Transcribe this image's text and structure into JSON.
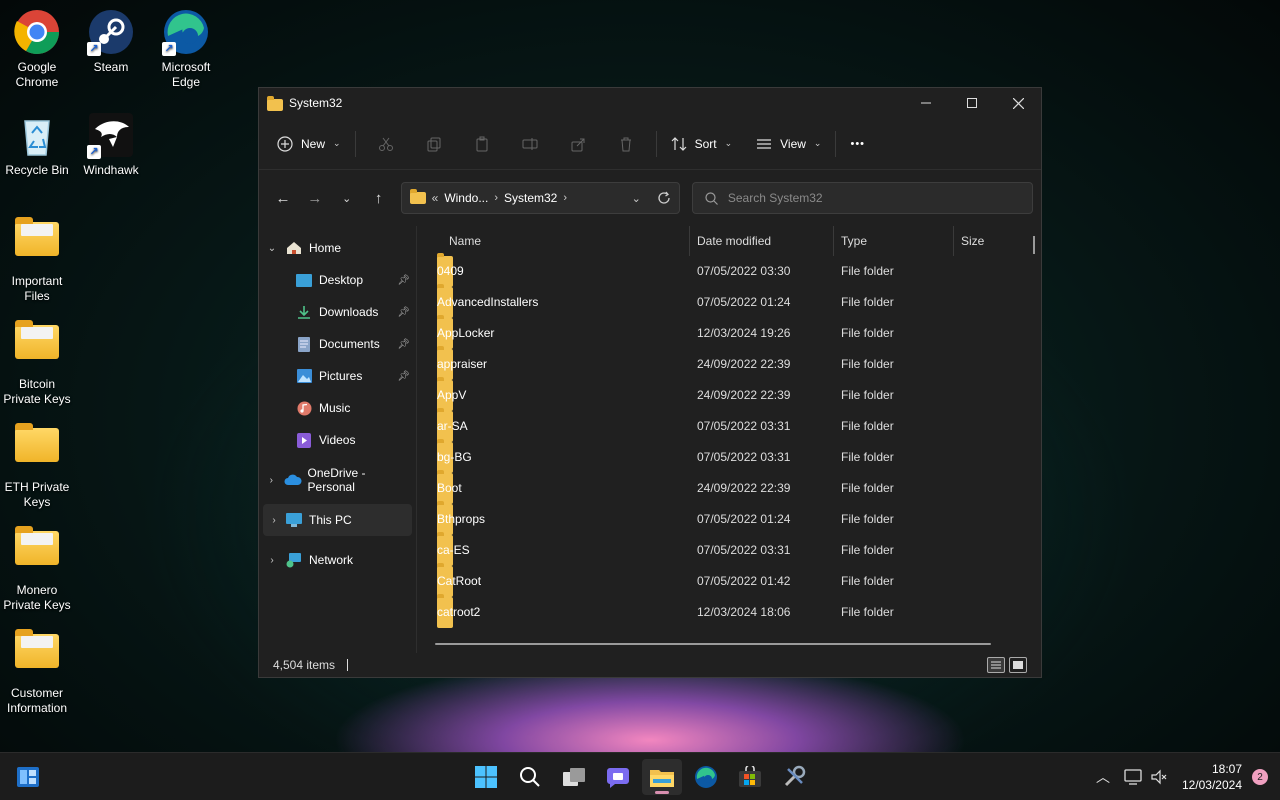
{
  "desktop": {
    "icons": [
      {
        "label": "Google Chrome"
      },
      {
        "label": "Steam"
      },
      {
        "label": "Microsoft Edge"
      },
      {
        "label": "Recycle Bin"
      },
      {
        "label": "Windhawk"
      },
      {
        "label": "Important Files"
      },
      {
        "label": "Bitcoin Private Keys"
      },
      {
        "label": "ETH Private Keys"
      },
      {
        "label": "Monero Private Keys"
      },
      {
        "label": "Customer Information"
      }
    ]
  },
  "window": {
    "title": "System32",
    "toolbar": {
      "new_label": "New",
      "sort_label": "Sort",
      "view_label": "View",
      "more_label": "•••"
    },
    "address": {
      "crumb_prefix": "«",
      "crumb1": "Windo...",
      "crumb2": "System32"
    },
    "search": {
      "placeholder": "Search System32"
    },
    "sidebar": {
      "home": "Home",
      "quick": [
        {
          "label": "Desktop",
          "pinned": true
        },
        {
          "label": "Downloads",
          "pinned": true
        },
        {
          "label": "Documents",
          "pinned": true
        },
        {
          "label": "Pictures",
          "pinned": true
        },
        {
          "label": "Music",
          "pinned": false
        },
        {
          "label": "Videos",
          "pinned": false
        }
      ],
      "onedrive": "OneDrive - Personal",
      "thispc": "This PC",
      "network": "Network"
    },
    "columns": {
      "name": "Name",
      "date": "Date modified",
      "type": "Type",
      "size": "Size"
    },
    "files": [
      {
        "name": "0409",
        "date": "07/05/2022 03:30",
        "type": "File folder"
      },
      {
        "name": "AdvancedInstallers",
        "date": "07/05/2022 01:24",
        "type": "File folder"
      },
      {
        "name": "AppLocker",
        "date": "12/03/2024 19:26",
        "type": "File folder"
      },
      {
        "name": "appraiser",
        "date": "24/09/2022 22:39",
        "type": "File folder"
      },
      {
        "name": "AppV",
        "date": "24/09/2022 22:39",
        "type": "File folder"
      },
      {
        "name": "ar-SA",
        "date": "07/05/2022 03:31",
        "type": "File folder"
      },
      {
        "name": "bg-BG",
        "date": "07/05/2022 03:31",
        "type": "File folder"
      },
      {
        "name": "Boot",
        "date": "24/09/2022 22:39",
        "type": "File folder"
      },
      {
        "name": "Bthprops",
        "date": "07/05/2022 01:24",
        "type": "File folder"
      },
      {
        "name": "ca-ES",
        "date": "07/05/2022 03:31",
        "type": "File folder"
      },
      {
        "name": "CatRoot",
        "date": "07/05/2022 01:42",
        "type": "File folder"
      },
      {
        "name": "catroot2",
        "date": "12/03/2024 18:06",
        "type": "File folder"
      }
    ],
    "status": {
      "items": "4,504 items"
    }
  },
  "taskbar": {
    "time": "18:07",
    "date": "12/03/2024",
    "badge": "2"
  },
  "colors": {
    "accent": "#4cc2ff",
    "folder": "#f2c14e",
    "window_bg": "#202020"
  }
}
